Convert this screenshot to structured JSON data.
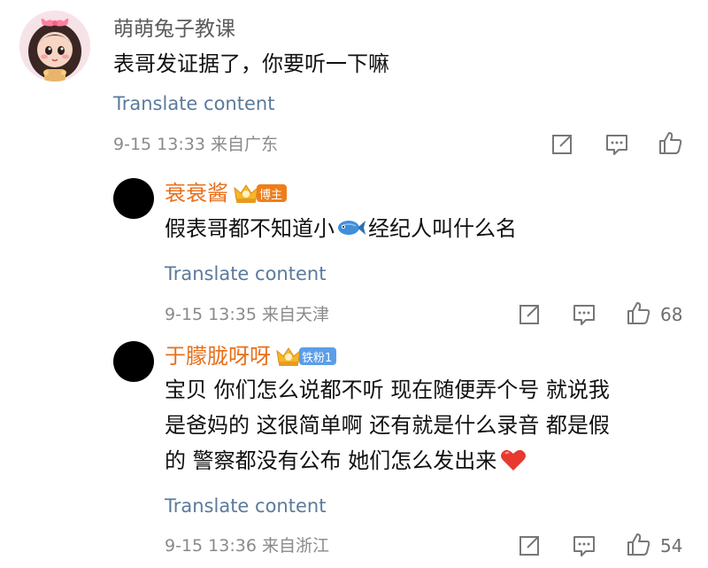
{
  "comment1": {
    "username": "萌萌兔子教课",
    "text": "表哥发证据了，你要听一下嘛",
    "translate": "Translate content",
    "meta": "9-15 13:33  来自广东"
  },
  "reply1": {
    "username": "衰衰酱",
    "badge": "博主",
    "text_before": "假表哥都不知道小",
    "text_after": "经纪人叫什么名",
    "translate": "Translate content",
    "meta": "9-15 13:35  来自天津",
    "likes": "68"
  },
  "reply2": {
    "username": "于朦胧呀呀",
    "badge": "铁粉1",
    "line1": "宝贝 你们怎么说都不听 现在随便弄个号 就说我",
    "line2": "是爸妈的 这很简单啊 还有就是什么录音 都是假",
    "line3": "的 警察都没有公布 她们怎么发出来",
    "translate": "Translate content",
    "meta": "9-15 13:36  来自浙江",
    "likes": "54"
  },
  "colors": {
    "username_orange": "#e86f1a",
    "link_blue": "#5b7a9c",
    "badge_orange": "#ee7e1b",
    "badge_blue": "#5b9ee8"
  },
  "icons": [
    "share-icon",
    "comment-icon",
    "like-icon",
    "fish-emoji",
    "red-heart-emoji",
    "crown-icon"
  ]
}
